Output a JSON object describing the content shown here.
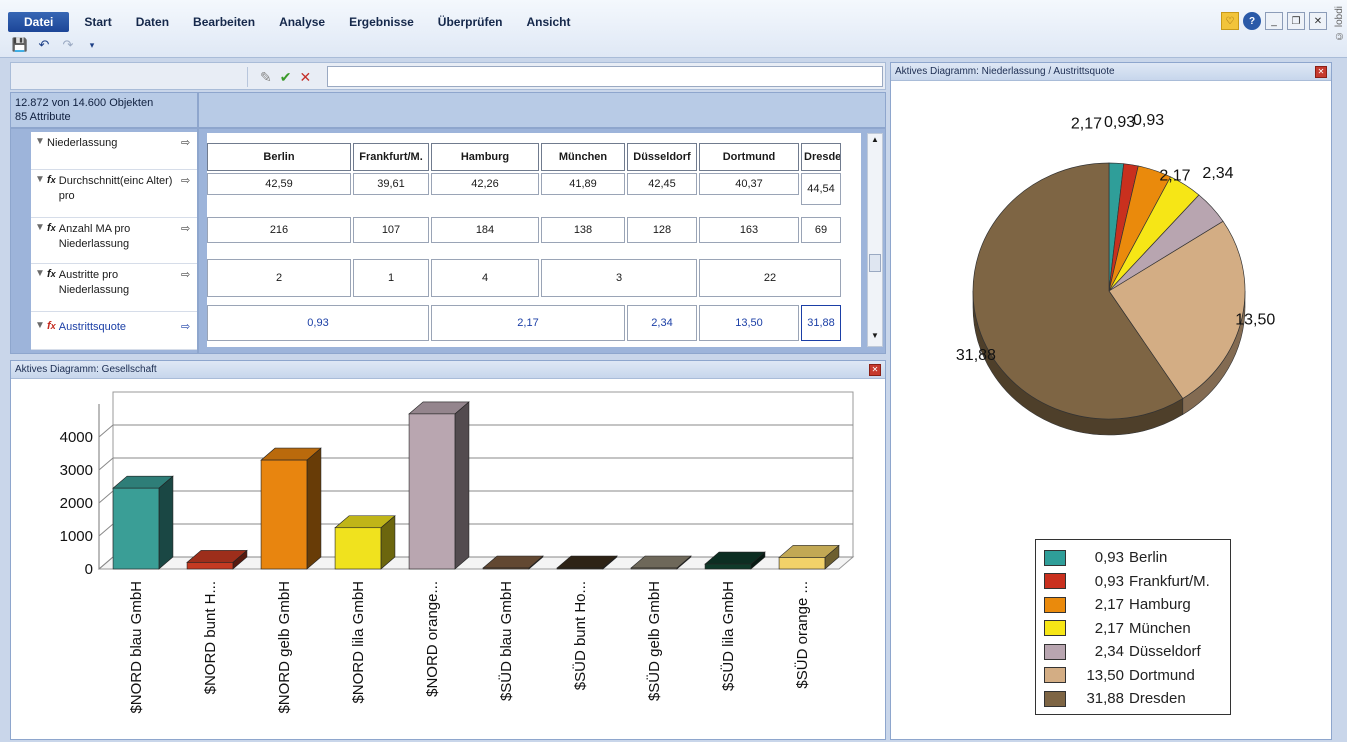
{
  "ribbon": {
    "menu": [
      "Datei",
      "Start",
      "Daten",
      "Bearbeiten",
      "Analyse",
      "Ergebnisse",
      "Überprüfen",
      "Ansicht"
    ],
    "active_menu": "Datei",
    "qat_icons": [
      "save-icon",
      "undo-icon",
      "redo-icon",
      "customize-icon"
    ],
    "window_icons": [
      "favorite-icon",
      "help-icon",
      "minimize-icon",
      "restore-icon",
      "close-icon"
    ],
    "copyright": "© lobdi"
  },
  "formula": {
    "icons": [
      "edit-pencil-icon",
      "confirm-check-icon",
      "cancel-x-icon"
    ],
    "value": ""
  },
  "objects": {
    "count_line": "12.872 von 14.600 Objekten",
    "attr_line": "85 Attribute"
  },
  "attributes": [
    {
      "label": "Niederlassung",
      "fx": false
    },
    {
      "label": "Durchschnitt(einc Alter) pro",
      "fx": true
    },
    {
      "label": "Anzahl MA pro Niederlassung",
      "fx": true
    },
    {
      "label": "Austritte pro Niederlassung",
      "fx": true
    },
    {
      "label": "Austrittsquote",
      "fx": true,
      "highlight": true
    }
  ],
  "grid": {
    "headers": [
      "Berlin",
      "Frankfurt/M.",
      "Hamburg",
      "München",
      "Düsseldorf",
      "Dortmund",
      "Dresde"
    ],
    "avg_age": [
      "42,59",
      "39,61",
      "42,26",
      "41,89",
      "42,45",
      "40,37",
      "44,54"
    ],
    "employees": [
      "216",
      "107",
      "184",
      "138",
      "128",
      "163",
      "69"
    ],
    "exits": [
      "2",
      "1",
      "4",
      "3",
      "22"
    ],
    "quota": [
      "0,93",
      "2,17",
      "2,34",
      "13,50",
      "31,88"
    ]
  },
  "bar_panel": {
    "title": "Aktives Diagramm: Gesellschaft"
  },
  "pie_panel": {
    "title": "Aktives Diagramm: Niederlassung / Austrittsquote"
  },
  "chart_data": [
    {
      "type": "bar",
      "title": "",
      "categories": [
        "$NORD blau GmbH",
        "$NORD bunt H...",
        "$NORD gelb GmbH",
        "$NORD lila GmbH",
        "$NORD orange...",
        "$SÜD blau GmbH",
        "$SÜD bunt Ho...",
        "$SÜD gelb GmbH",
        "$SÜD lila GmbH",
        "$SÜD orange ..."
      ],
      "values": [
        2450,
        200,
        3300,
        1250,
        4700,
        30,
        30,
        30,
        150,
        350
      ],
      "colors": [
        "#3a9e96",
        "#c43a22",
        "#e8850f",
        "#f0e21e",
        "#b9a6b0",
        "#7a5a3e",
        "#3a2c1c",
        "#8a8270",
        "#0f3a2a",
        "#f2d269"
      ],
      "yticks": [
        "0",
        "1000",
        "2000",
        "3000",
        "4000"
      ],
      "ylim": [
        0,
        5000
      ],
      "grid": true
    },
    {
      "type": "pie",
      "labels": [
        "Berlin",
        "Frankfurt/M.",
        "Hamburg",
        "München",
        "Düsseldorf",
        "Dortmund",
        "Dresden"
      ],
      "values": [
        0.93,
        0.93,
        2.17,
        2.17,
        2.34,
        13.5,
        31.88
      ],
      "value_labels": [
        "0,93",
        "0,93",
        "2,17",
        "2,17",
        "2,34",
        "13,50",
        "31,88"
      ],
      "colors": [
        "#2f9e99",
        "#c9301e",
        "#ea8a0c",
        "#f6e616",
        "#b8a5b0",
        "#d3ad84",
        "#7e6544"
      ],
      "legend": "bottom"
    }
  ]
}
